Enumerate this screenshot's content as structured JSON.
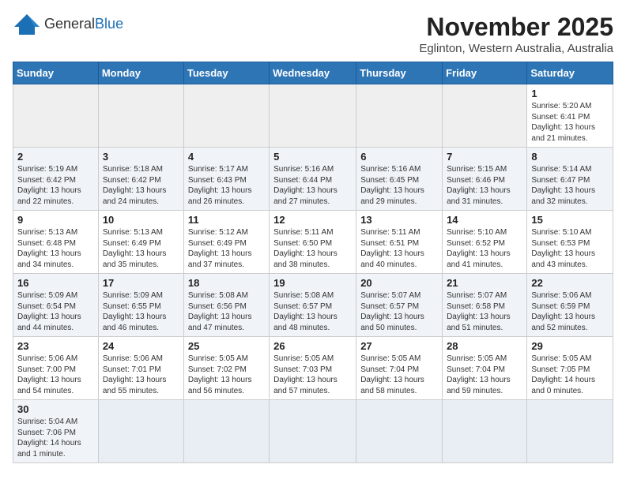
{
  "header": {
    "logo_general": "General",
    "logo_blue": "Blue",
    "month_title": "November 2025",
    "subtitle": "Eglinton, Western Australia, Australia"
  },
  "weekdays": [
    "Sunday",
    "Monday",
    "Tuesday",
    "Wednesday",
    "Thursday",
    "Friday",
    "Saturday"
  ],
  "weeks": [
    [
      {
        "day": "",
        "info": ""
      },
      {
        "day": "",
        "info": ""
      },
      {
        "day": "",
        "info": ""
      },
      {
        "day": "",
        "info": ""
      },
      {
        "day": "",
        "info": ""
      },
      {
        "day": "",
        "info": ""
      },
      {
        "day": "1",
        "info": "Sunrise: 5:20 AM\nSunset: 6:41 PM\nDaylight: 13 hours\nand 21 minutes."
      }
    ],
    [
      {
        "day": "2",
        "info": "Sunrise: 5:19 AM\nSunset: 6:42 PM\nDaylight: 13 hours\nand 22 minutes."
      },
      {
        "day": "3",
        "info": "Sunrise: 5:18 AM\nSunset: 6:42 PM\nDaylight: 13 hours\nand 24 minutes."
      },
      {
        "day": "4",
        "info": "Sunrise: 5:17 AM\nSunset: 6:43 PM\nDaylight: 13 hours\nand 26 minutes."
      },
      {
        "day": "5",
        "info": "Sunrise: 5:16 AM\nSunset: 6:44 PM\nDaylight: 13 hours\nand 27 minutes."
      },
      {
        "day": "6",
        "info": "Sunrise: 5:16 AM\nSunset: 6:45 PM\nDaylight: 13 hours\nand 29 minutes."
      },
      {
        "day": "7",
        "info": "Sunrise: 5:15 AM\nSunset: 6:46 PM\nDaylight: 13 hours\nand 31 minutes."
      },
      {
        "day": "8",
        "info": "Sunrise: 5:14 AM\nSunset: 6:47 PM\nDaylight: 13 hours\nand 32 minutes."
      }
    ],
    [
      {
        "day": "9",
        "info": "Sunrise: 5:13 AM\nSunset: 6:48 PM\nDaylight: 13 hours\nand 34 minutes."
      },
      {
        "day": "10",
        "info": "Sunrise: 5:13 AM\nSunset: 6:49 PM\nDaylight: 13 hours\nand 35 minutes."
      },
      {
        "day": "11",
        "info": "Sunrise: 5:12 AM\nSunset: 6:49 PM\nDaylight: 13 hours\nand 37 minutes."
      },
      {
        "day": "12",
        "info": "Sunrise: 5:11 AM\nSunset: 6:50 PM\nDaylight: 13 hours\nand 38 minutes."
      },
      {
        "day": "13",
        "info": "Sunrise: 5:11 AM\nSunset: 6:51 PM\nDaylight: 13 hours\nand 40 minutes."
      },
      {
        "day": "14",
        "info": "Sunrise: 5:10 AM\nSunset: 6:52 PM\nDaylight: 13 hours\nand 41 minutes."
      },
      {
        "day": "15",
        "info": "Sunrise: 5:10 AM\nSunset: 6:53 PM\nDaylight: 13 hours\nand 43 minutes."
      }
    ],
    [
      {
        "day": "16",
        "info": "Sunrise: 5:09 AM\nSunset: 6:54 PM\nDaylight: 13 hours\nand 44 minutes."
      },
      {
        "day": "17",
        "info": "Sunrise: 5:09 AM\nSunset: 6:55 PM\nDaylight: 13 hours\nand 46 minutes."
      },
      {
        "day": "18",
        "info": "Sunrise: 5:08 AM\nSunset: 6:56 PM\nDaylight: 13 hours\nand 47 minutes."
      },
      {
        "day": "19",
        "info": "Sunrise: 5:08 AM\nSunset: 6:57 PM\nDaylight: 13 hours\nand 48 minutes."
      },
      {
        "day": "20",
        "info": "Sunrise: 5:07 AM\nSunset: 6:57 PM\nDaylight: 13 hours\nand 50 minutes."
      },
      {
        "day": "21",
        "info": "Sunrise: 5:07 AM\nSunset: 6:58 PM\nDaylight: 13 hours\nand 51 minutes."
      },
      {
        "day": "22",
        "info": "Sunrise: 5:06 AM\nSunset: 6:59 PM\nDaylight: 13 hours\nand 52 minutes."
      }
    ],
    [
      {
        "day": "23",
        "info": "Sunrise: 5:06 AM\nSunset: 7:00 PM\nDaylight: 13 hours\nand 54 minutes."
      },
      {
        "day": "24",
        "info": "Sunrise: 5:06 AM\nSunset: 7:01 PM\nDaylight: 13 hours\nand 55 minutes."
      },
      {
        "day": "25",
        "info": "Sunrise: 5:05 AM\nSunset: 7:02 PM\nDaylight: 13 hours\nand 56 minutes."
      },
      {
        "day": "26",
        "info": "Sunrise: 5:05 AM\nSunset: 7:03 PM\nDaylight: 13 hours\nand 57 minutes."
      },
      {
        "day": "27",
        "info": "Sunrise: 5:05 AM\nSunset: 7:04 PM\nDaylight: 13 hours\nand 58 minutes."
      },
      {
        "day": "28",
        "info": "Sunrise: 5:05 AM\nSunset: 7:04 PM\nDaylight: 13 hours\nand 59 minutes."
      },
      {
        "day": "29",
        "info": "Sunrise: 5:05 AM\nSunset: 7:05 PM\nDaylight: 14 hours\nand 0 minutes."
      }
    ],
    [
      {
        "day": "30",
        "info": "Sunrise: 5:04 AM\nSunset: 7:06 PM\nDaylight: 14 hours\nand 1 minute."
      },
      {
        "day": "",
        "info": ""
      },
      {
        "day": "",
        "info": ""
      },
      {
        "day": "",
        "info": ""
      },
      {
        "day": "",
        "info": ""
      },
      {
        "day": "",
        "info": ""
      },
      {
        "day": "",
        "info": ""
      }
    ]
  ]
}
